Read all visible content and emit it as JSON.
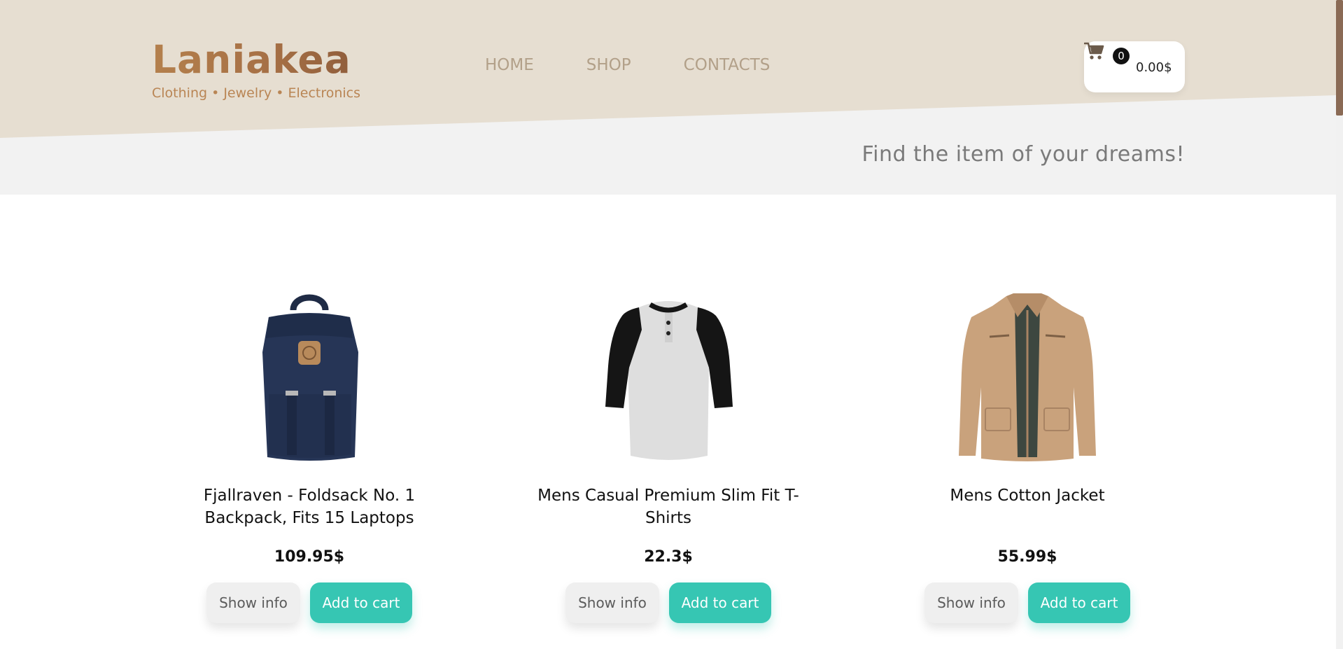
{
  "brand": {
    "name": "Laniakea",
    "tagline": "Clothing • Jewelry • Electronics"
  },
  "nav": {
    "items": [
      {
        "label": "HOME"
      },
      {
        "label": "SHOP"
      },
      {
        "label": "CONTACTS"
      }
    ]
  },
  "cart": {
    "count": "0",
    "total": "0.00$",
    "icon": "shopping-cart-icon"
  },
  "hero": {
    "tagline": "Find the item of your dreams!"
  },
  "products": [
    {
      "title": "Fjallraven - Foldsack No. 1 Backpack, Fits 15 Laptops",
      "price": "109.95$",
      "image": "navy-backpack-image",
      "info_label": "Show info",
      "cart_label": "Add to cart"
    },
    {
      "title": "Mens Casual Premium Slim Fit T-Shirts",
      "price": "22.3$",
      "image": "raglan-tshirt-image",
      "info_label": "Show info",
      "cart_label": "Add to cart"
    },
    {
      "title": "Mens Cotton Jacket",
      "price": "55.99$",
      "image": "beige-jacket-image",
      "info_label": "Show info",
      "cart_label": "Add to cart"
    }
  ],
  "colors": {
    "header_bg": "#e6ded1",
    "accent": "#36c6b3",
    "brand": "#a56f45",
    "nav_text": "#b2a089"
  }
}
